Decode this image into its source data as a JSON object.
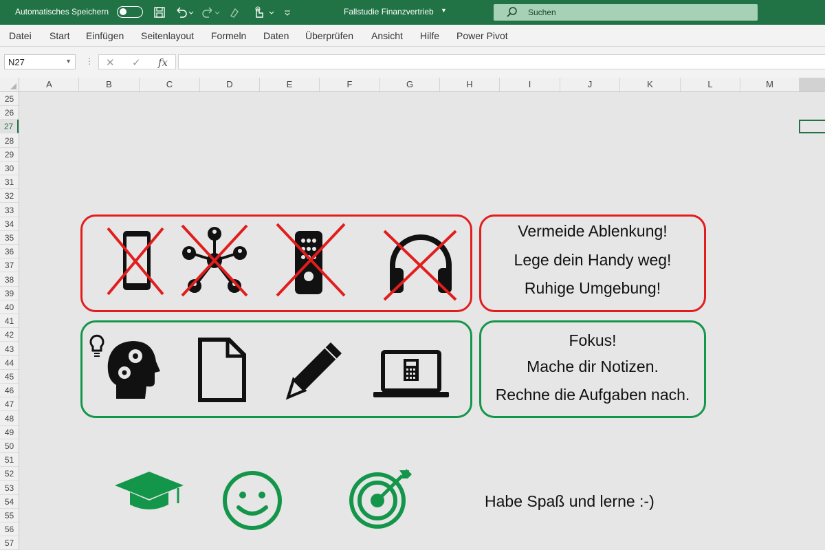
{
  "titlebar": {
    "autosave_label": "Automatisches Speichern",
    "document_title": "Fallstudie Finanzvertrieb",
    "search_placeholder": "Suchen"
  },
  "menu": [
    "Datei",
    "Start",
    "Einfügen",
    "Seitenlayout",
    "Formeln",
    "Daten",
    "Überprüfen",
    "Ansicht",
    "Hilfe",
    "Power Pivot"
  ],
  "formula_bar": {
    "name_box": "N27",
    "fx_label": "fx",
    "formula": ""
  },
  "columns": [
    "A",
    "B",
    "C",
    "D",
    "E",
    "F",
    "G",
    "H",
    "I",
    "J",
    "K",
    "L",
    "M"
  ],
  "rows": [
    "25",
    "26",
    "27",
    "28",
    "29",
    "30",
    "31",
    "32",
    "33",
    "34",
    "35",
    "36",
    "37",
    "38",
    "39",
    "40",
    "41",
    "42",
    "43",
    "44",
    "45",
    "46",
    "47",
    "48",
    "49",
    "50",
    "51",
    "52",
    "53",
    "54",
    "55",
    "56",
    "57"
  ],
  "active_row": "27",
  "box_distractions": {
    "icons": [
      "smartphone-icon",
      "social-network-icon",
      "remote-control-icon",
      "headphones-icon"
    ],
    "text_lines": [
      "Vermeide Ablenkung!",
      "Lege dein Handy weg!",
      "Ruhige Umgebung!"
    ]
  },
  "box_focus": {
    "icons": [
      "head-gears-lightbulb-icon",
      "document-icon",
      "pencil-icon",
      "laptop-calculator-icon"
    ],
    "text_lines": [
      "Fokus!",
      "Mache dir Notizen.",
      "Rechne die Aufgaben nach."
    ]
  },
  "bottom": {
    "icons": [
      "graduation-cap-icon",
      "smiley-icon",
      "target-icon"
    ],
    "text": "Habe Spaß und lerne :-)"
  },
  "colors": {
    "excel_green": "#217346",
    "red": "#e11d1d",
    "green": "#14964a"
  }
}
